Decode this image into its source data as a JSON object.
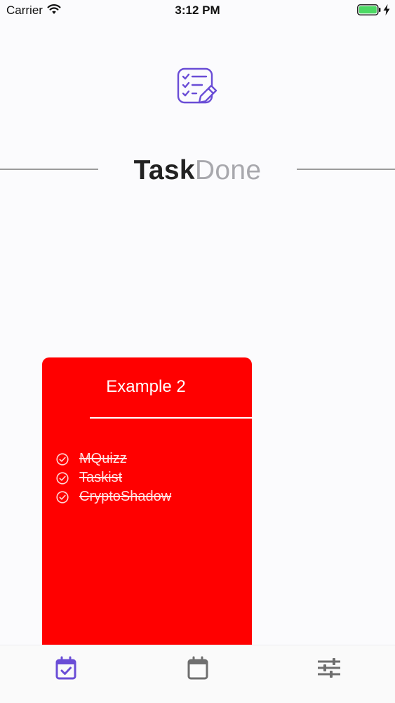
{
  "status_bar": {
    "carrier": "Carrier",
    "time": "3:12 PM",
    "battery_color": "#4cd964"
  },
  "header": {
    "app_icon": "checklist-edit-icon",
    "brand_bold": "Task",
    "brand_light": "Done",
    "accent_color": "#6a4dd6"
  },
  "card": {
    "title": "Example 2",
    "color": "#ff0000",
    "tasks": [
      {
        "label": "MQuizz",
        "done": true
      },
      {
        "label": "Taskist",
        "done": true
      },
      {
        "label": "CryptoShadow",
        "done": true
      }
    ]
  },
  "tab_bar": {
    "tabs": [
      {
        "icon": "calendar-check-icon",
        "active": true
      },
      {
        "icon": "calendar-icon",
        "active": false
      },
      {
        "icon": "sliders-icon",
        "active": false
      }
    ],
    "active_color": "#6a4dd6",
    "inactive_color": "#6e6e6e"
  }
}
